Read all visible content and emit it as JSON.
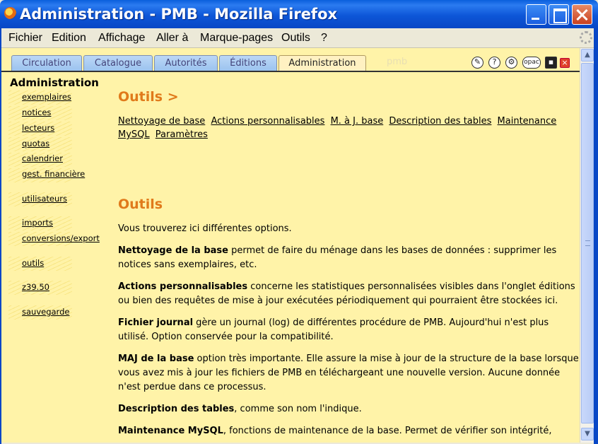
{
  "window": {
    "title": "Administration - PMB - Mozilla Firefox"
  },
  "menu": [
    "Fichier",
    "Edition",
    "Affichage",
    "Aller à",
    "Marque-pages",
    "Outils",
    "?"
  ],
  "tabs": [
    "Circulation",
    "Catalogue",
    "Autorités",
    "Éditions",
    "Administration"
  ],
  "active_tab": "Administration",
  "faint_logo": "pmb",
  "toolbar_icons": [
    "help-icon",
    "question-icon",
    "preferences-icon",
    "opac-icon",
    "save-icon",
    "close-icon"
  ],
  "toolbar": {
    "opac_label": "opac"
  },
  "sidebar": {
    "title": "Administration",
    "items": [
      "exemplaires",
      "notices",
      "lecteurs",
      "quotas",
      "calendrier",
      "gest. financière",
      "utilisateurs",
      "imports",
      "conversions/export",
      "outils",
      "z39.50",
      "sauvegarde"
    ]
  },
  "main": {
    "breadcrumb": "Outils >",
    "links": [
      "Nettoyage de base",
      "Actions personnalisables",
      "M. à J. base",
      "Description des tables",
      "Maintenance MySQL",
      "Paramètres"
    ],
    "section_title": "Outils",
    "intro": "Vous trouverez ici différentes options.",
    "paragraphs": [
      {
        "term": "Nettoyage de la base",
        "text": " permet de faire du ménage dans les bases de données : supprimer les notices sans exemplaires, etc."
      },
      {
        "term": "Actions personnalisables",
        "text": " concerne les statistiques personnalisées visibles dans l'onglet éditions ou bien des requêtes de mise à jour exécutées périodiquement qui pourraient être stockées ici."
      },
      {
        "term": "Fichier journal",
        "text": " gère un journal (log) de différentes procédure de PMB. Aujourd'hui n'est plus utilisé. Option conservée pour la compatibilité."
      },
      {
        "term": "MAJ de la base",
        "text": " option très importante. Elle assure la mise à jour de la structure de la base lorsque vous avez mis à jour les fichiers de PMB en téléchargeant une nouvelle version. Aucune donnée n'est perdue dans ce processus."
      },
      {
        "term": "Description des tables",
        "text": ", comme son nom l'indique."
      },
      {
        "term": "Maintenance MySQL",
        "text": ", fonctions de maintenance de la base. Permet de vérifier son intégrité,"
      }
    ]
  }
}
